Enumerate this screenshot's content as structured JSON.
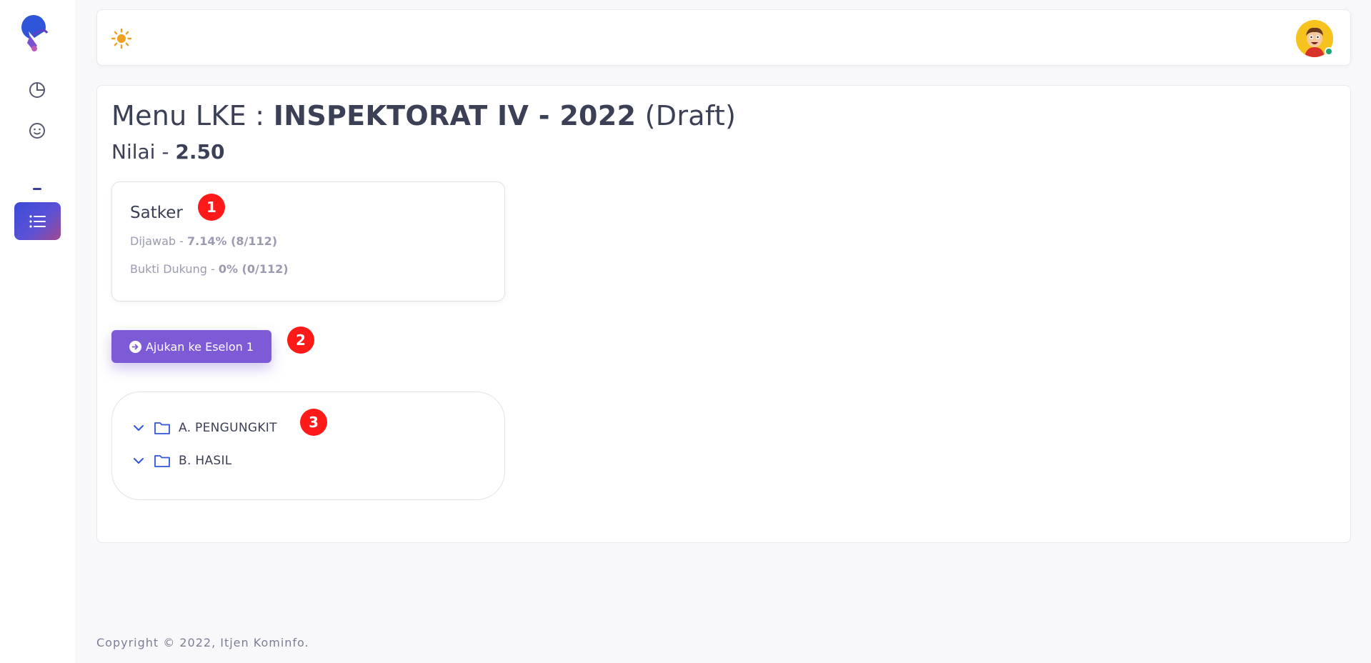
{
  "header": {
    "theme_toggle_icon": "sun-icon",
    "avatar_icon": "user-avatar",
    "status_color": "#1ba37a"
  },
  "sidebar": {
    "items": [
      {
        "icon": "pie-chart-icon"
      },
      {
        "icon": "smiley-icon"
      },
      {
        "icon": "list-icon",
        "active": true
      }
    ],
    "accent": "#3c4bd6"
  },
  "main": {
    "title_prefix": "Menu LKE : ",
    "title_bold": "INSPEKTORAT IV - 2022",
    "title_suffix": " (Draft)",
    "nilai_label": "Nilai - ",
    "nilai_value": "2.50"
  },
  "satker": {
    "title": "Satker",
    "dijawab_label": "Dijawab - ",
    "dijawab_value": "7.14% (8/112)",
    "bukti_label": "Bukti Dukung - ",
    "bukti_value": "0% (0/112)"
  },
  "action": {
    "submit_label": "Ajukan ke Eselon 1",
    "color": "#7e5bd6"
  },
  "tree": {
    "items": [
      {
        "label": "A. PENGUNGKIT"
      },
      {
        "label": "B. HASIL"
      }
    ]
  },
  "badges": [
    "1",
    "2",
    "3"
  ],
  "footer": {
    "copyright": "Copyright © 2022, Itjen Kominfo."
  }
}
